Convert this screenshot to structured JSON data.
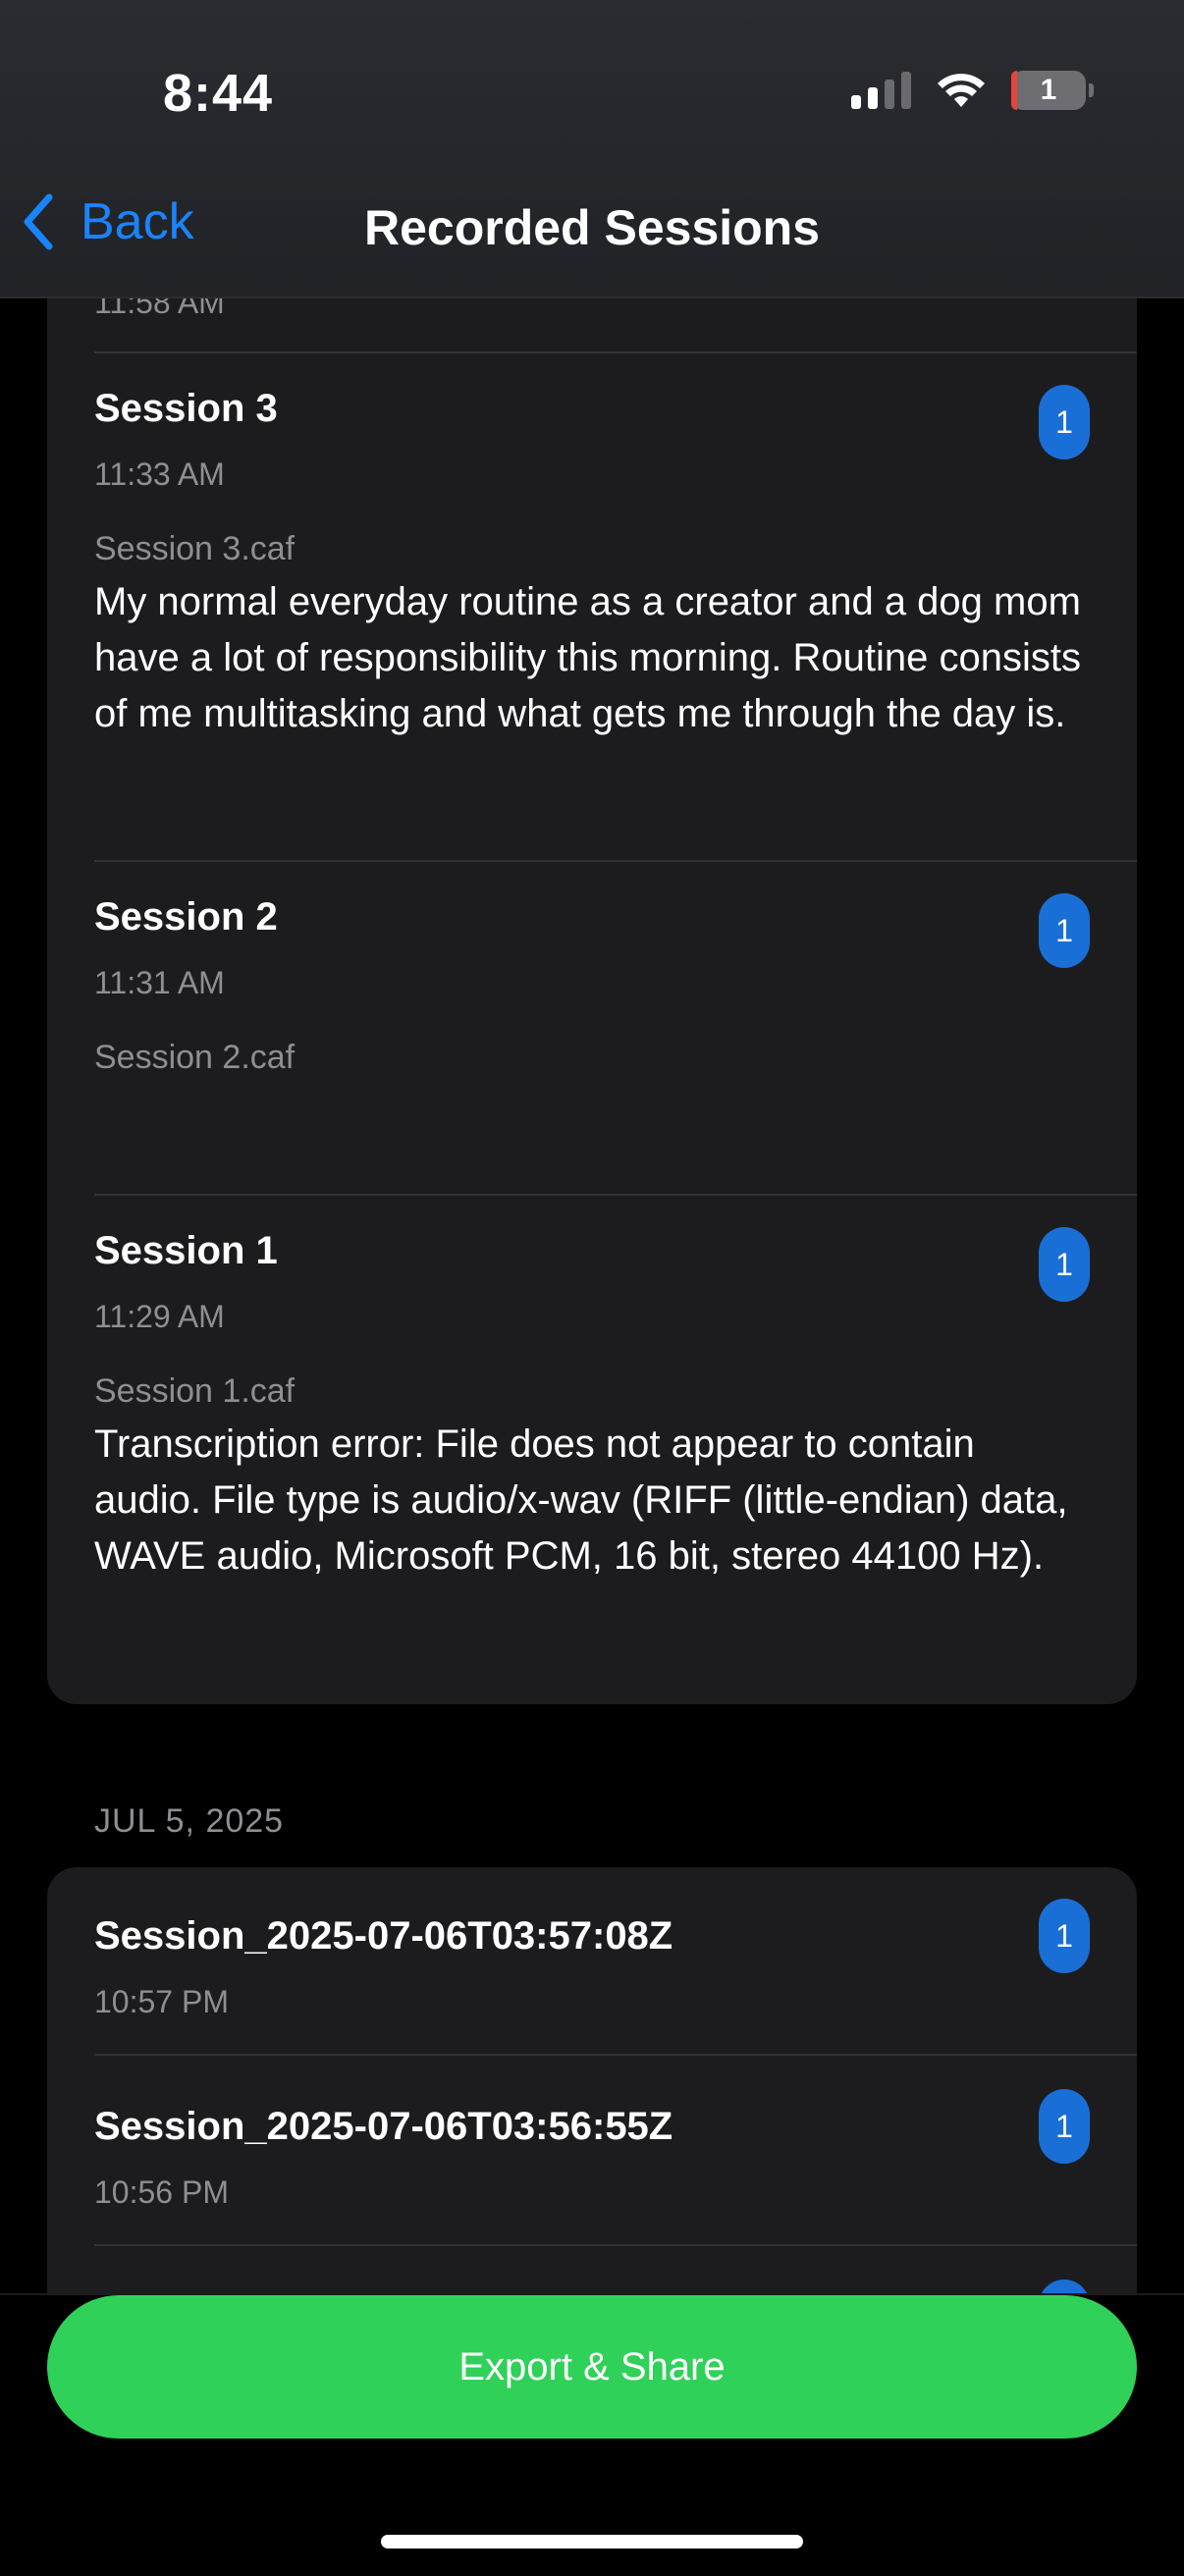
{
  "status": {
    "time": "8:44",
    "battery": "1"
  },
  "nav": {
    "back_label": "Back",
    "title": "Recorded Sessions"
  },
  "group1": {
    "prev_time": "11:58 AM",
    "sessions": [
      {
        "title": "Session 3",
        "time": "11:33 AM",
        "file": "Session 3.caf",
        "badge": "1",
        "text": "My normal everyday routine as a creator and a dog mom have a lot of responsibility this morning. Routine consists of me multitasking and what gets me through the day is."
      },
      {
        "title": "Session 2",
        "time": "11:31 AM",
        "file": "Session 2.caf",
        "badge": "1",
        "text": ""
      },
      {
        "title": "Session 1",
        "time": "11:29 AM",
        "file": "Session 1.caf",
        "badge": "1",
        "text": "Transcription error: File does not appear to contain audio. File type is audio/x-wav (RIFF (little-endian) data, WAVE audio, Microsoft PCM, 16 bit, stereo 44100 Hz)."
      }
    ]
  },
  "group2": {
    "date_label": "JUL 5, 2025",
    "sessions": [
      {
        "title": "Session_2025-07-06T03:57:08Z",
        "time": "10:57 PM",
        "badge": "1"
      },
      {
        "title": "Session_2025-07-06T03:56:55Z",
        "time": "10:56 PM",
        "badge": "1"
      },
      {
        "badge": "1"
      }
    ]
  },
  "footer": {
    "export_label": "Export & Share"
  },
  "colors": {
    "accent": "#1a84ff",
    "badge": "#1a6fd6",
    "export": "#30d158"
  }
}
